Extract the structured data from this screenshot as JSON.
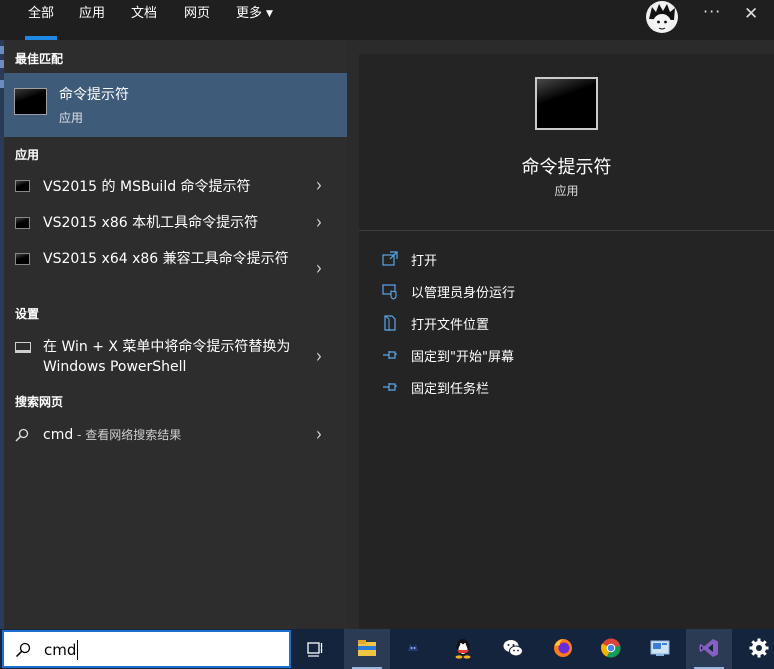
{
  "tabs": [
    "全部",
    "应用",
    "文档",
    "网页",
    "更多"
  ],
  "best_match": {
    "section": "最佳匹配",
    "title": "命令提示符",
    "subtitle": "应用"
  },
  "apps": {
    "section": "应用",
    "items": [
      {
        "label": "VS2015 的 MSBuild 命令提示符"
      },
      {
        "label": "VS2015 x86 本机工具命令提示符"
      },
      {
        "label": "VS2015 x64 x86 兼容工具命令提示符"
      }
    ]
  },
  "settings": {
    "section": "设置",
    "item_label": "在 Win + X 菜单中将命令提示符替换为 Windows PowerShell"
  },
  "web": {
    "section": "搜索网页",
    "query": "cmd",
    "suffix": " - 查看网络搜索结果"
  },
  "detail": {
    "title": "命令提示符",
    "subtitle": "应用",
    "actions": [
      {
        "label": "打开",
        "icon": "open-icon"
      },
      {
        "label": "以管理员身份运行",
        "icon": "shield-admin-icon"
      },
      {
        "label": "打开文件位置",
        "icon": "file-location-icon"
      },
      {
        "label": "固定到\"开始\"屏幕",
        "icon": "pin-icon"
      },
      {
        "label": "固定到任务栏",
        "icon": "pin-icon"
      }
    ]
  },
  "search": {
    "value": "cmd"
  },
  "taskbar": {
    "items": [
      "task-view-icon",
      "file-explorer-icon",
      "game-app-icon",
      "qq-icon",
      "wechat-icon",
      "firefox-icon",
      "chrome-icon",
      "remote-desktop-icon",
      "visual-studio-icon",
      "settings-gear-icon"
    ]
  },
  "colors": {
    "accent": "#1e88e5",
    "selected_bg": "#3e5b7a",
    "taskbar_bg": "#14243d",
    "action_icon": "#5aa7e8"
  }
}
